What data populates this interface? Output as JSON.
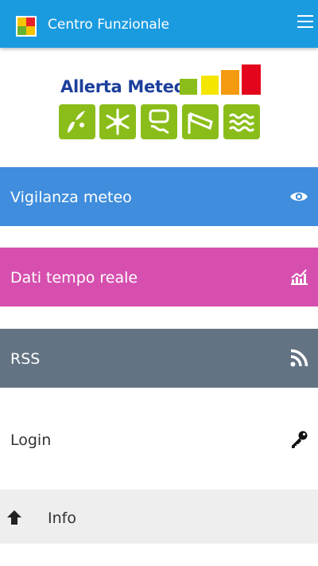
{
  "header": {
    "title": "Centro Funzionale",
    "app_icon": "traffic-square-logo",
    "menu_icon": "hamburger-menu-icon"
  },
  "logo": {
    "title": "Allerta Meteo",
    "alert_level_colors": [
      "#8bbd1a",
      "#f5e600",
      "#f39a11",
      "#e3051b"
    ],
    "hazard_icons": [
      "rain-icon",
      "snow-icon",
      "ice-road-icon",
      "wind-icon",
      "waves-icon"
    ]
  },
  "menu": {
    "items": [
      {
        "label": "Vigilanza meteo",
        "icon": "eye-icon",
        "color": "#3f8ddc"
      },
      {
        "label": "Dati tempo reale",
        "icon": "chart-icon",
        "color": "#d64fae"
      },
      {
        "label": "RSS",
        "icon": "rss-icon",
        "color": "#637383"
      },
      {
        "label": "Login",
        "icon": "key-icon",
        "color": "#ffffff"
      }
    ]
  },
  "footer": {
    "info_label": "Info",
    "info_icon": "arrow-up-icon"
  }
}
